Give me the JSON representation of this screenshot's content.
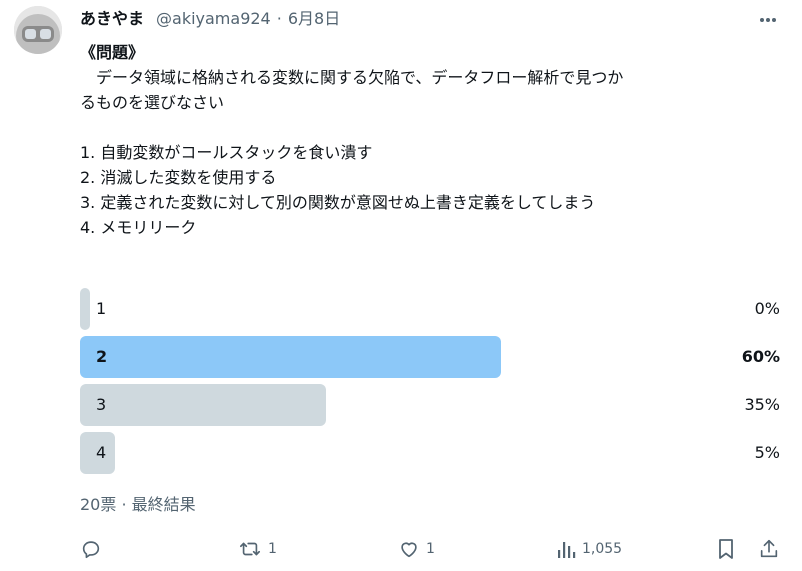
{
  "author": {
    "name": "あきやま",
    "name_badge": "󠄀",
    "handle": "@akiyama924",
    "separator": "·",
    "date": "6月8日"
  },
  "post": {
    "title": "《問題》",
    "question_line1": "　データ領域に格納される変数に関する欠陥で、データフロー解析で見つか",
    "question_line2": "るものを選びなさい",
    "choices": [
      "1. 自動変数がコールスタックを食い潰す",
      "2. 消滅した変数を使用する",
      "3. 定義された変数に対して別の関数が意図せぬ上書き定義をしてしまう",
      "4. メモリリーク"
    ]
  },
  "poll": {
    "options": [
      {
        "label": "1",
        "percent_text": "0%",
        "percent": 0,
        "winner": false
      },
      {
        "label": "2",
        "percent_text": "60%",
        "percent": 60,
        "winner": true
      },
      {
        "label": "3",
        "percent_text": "35%",
        "percent": 35,
        "winner": false
      },
      {
        "label": "4",
        "percent_text": "5%",
        "percent": 5,
        "winner": false
      }
    ],
    "votes": "20票",
    "separator": "·",
    "status": "最終結果"
  },
  "actions": {
    "reply_count": "",
    "repost_count": "1",
    "like_count": "1",
    "views_count": "1,055"
  },
  "icons": [
    "more-icon",
    "reply-icon",
    "repost-icon",
    "like-icon",
    "views-icon",
    "bookmark-icon",
    "share-icon"
  ],
  "colors": {
    "text": "#0f1419",
    "secondary": "#536471",
    "bar": "#cfd9de",
    "bar_winner": "#8cc8f8"
  }
}
